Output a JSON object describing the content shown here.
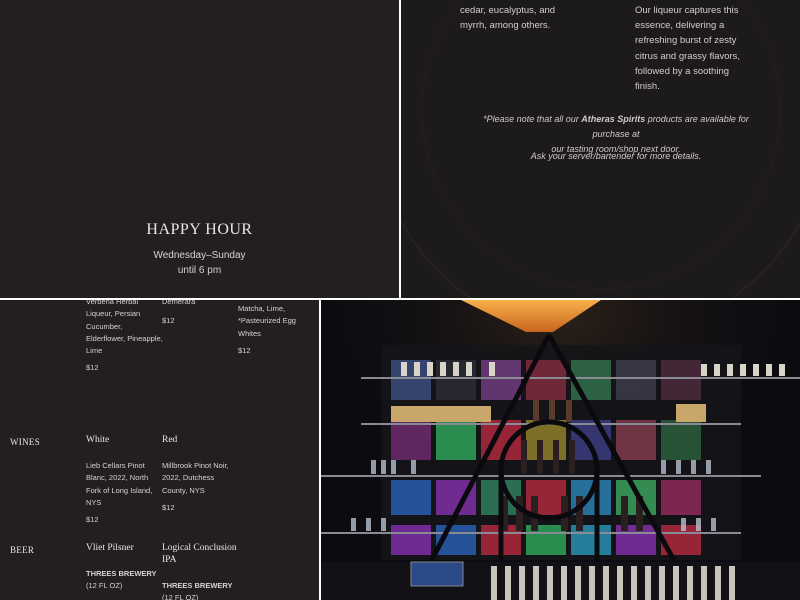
{
  "happy_hour": {
    "title": "HAPPY HOUR",
    "days": "Wednesday–Sunday",
    "time": "until 6 pm"
  },
  "liqueur_info": {
    "col1_lines": [
      "cedar, eucalyptus, and",
      "myrrh, among others."
    ],
    "col2_lines": [
      "Our liqueur captures this",
      "essence, delivering a",
      "refreshing burst of zesty",
      "citrus and grassy flavors,",
      "followed by a soothing",
      "finish."
    ],
    "note_prefix": "*Please note that all our ",
    "note_brand": "Atheras Spirits",
    "note_suffix_1": " products are available for purchase at",
    "note_line_2": "our tasting room/shop next door.",
    "ask_line": "Ask your server/bartender for more details."
  },
  "menu": {
    "cocktail_1": {
      "lines": [
        "Verbena Herbal",
        "Liqueur, Persian",
        "Cucumber,",
        "Elderflower, Pineapple,",
        "Lime"
      ],
      "price": "$12"
    },
    "cocktail_2": {
      "lines": [
        "Demerara"
      ],
      "price": "$12"
    },
    "cocktail_3": {
      "lines": [
        "Matcha, Lime,",
        "*Pasteurized Egg",
        "Whites"
      ],
      "price": "$12"
    },
    "wines": {
      "section": "WINES",
      "white": {
        "name": "White",
        "lines": [
          "Lieb Cellars Pinot",
          "Blanc, 2022, North",
          "Fork of Long Island,",
          "NYS"
        ],
        "price": "$12"
      },
      "red": {
        "name": "Red",
        "lines": [
          "Millbrook Pinot Noir,",
          "2022, Dutchess",
          "County, NYS"
        ],
        "price": "$12"
      }
    },
    "beer": {
      "section": "BEER",
      "beer_1": {
        "name": "Vliet Pilsner",
        "brewery": "THREES BREWERY",
        "size": "(12 FL OZ)"
      },
      "beer_2": {
        "name_line_1": "Logical Conclusion",
        "name_line_2": "IPA",
        "brewery": "THREES BREWERY",
        "size": "(12 FL OZ)"
      }
    }
  },
  "colors": {
    "panel_dark": "#231f20",
    "lamp_orange": "#e8892a",
    "glass_red": "#a4283c",
    "glass_green": "#2f9a58",
    "glass_blue": "#2a5aa8",
    "glass_purple": "#7a2fa0"
  }
}
